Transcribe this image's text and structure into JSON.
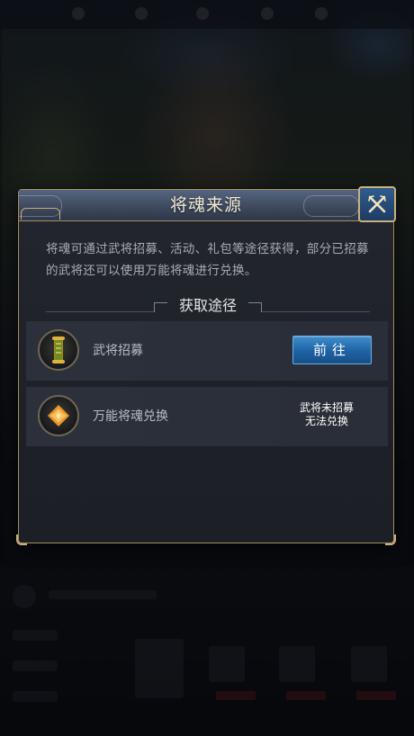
{
  "dialog": {
    "title": "将魂来源",
    "description": "将魂可通过武将招募、活动、礼包等途径获得，部分已招募的武将还可以使用万能将魂进行兑换。",
    "section_title": "获取途径",
    "sources": [
      {
        "label": "武将招募",
        "icon": "scroll-icon",
        "action_label": "前往"
      },
      {
        "label": "万能将魂兑换",
        "icon": "universal-soul-icon",
        "status_line1": "武将未招募",
        "status_line2": "无法兑换"
      }
    ]
  },
  "colors": {
    "frame_gold": "#a38f63",
    "title_bar": "#3e4a5f",
    "button_blue": "#1f62a4",
    "panel_bg": "#1e2128"
  }
}
